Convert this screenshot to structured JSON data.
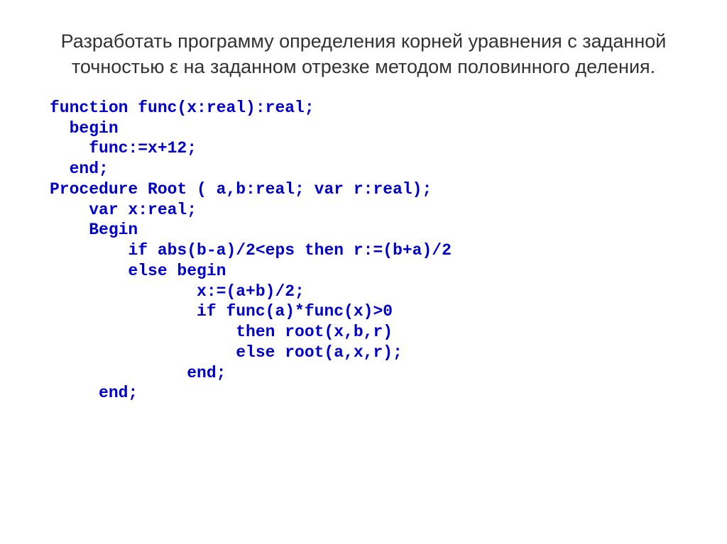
{
  "title": "Разработать программу определения корней уравнения с заданной точностью ε на заданном отрезке методом половинного деления.",
  "code": {
    "line1": "function func(x:real):real;",
    "line2": "  begin",
    "line3": "    func:=x+12;",
    "line4": "  end;",
    "line5": "Procedure Root ( a,b:real; var r:real);",
    "line6": "    var x:real;",
    "line7": "    Begin",
    "line8": "        if abs(b-a)/2<eps then r:=(b+a)/2",
    "line9": "        else begin",
    "line10": "               x:=(a+b)/2;",
    "line11": "               if func(a)*func(x)>0",
    "line12": "                   then root(x,b,r)",
    "line13": "                   else root(a,x,r);",
    "line14": "              end;",
    "line15": "     end;"
  }
}
